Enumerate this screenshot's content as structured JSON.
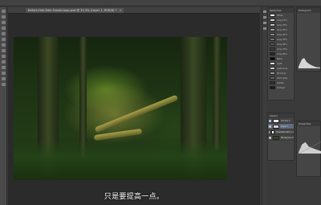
{
  "document": {
    "tab_title": "Before-Hoh-Rain-Forest-Loop.psd @ 33.3% (Layer 1, RGB/8) *",
    "close_glyph": "×"
  },
  "subtitle": "只是要提高一点。",
  "colors": {
    "workspace_bg": "#2b2b2b",
    "panel_bg": "#454545",
    "selected_layer": "#5e6c7f"
  },
  "panels": {
    "swatches": {
      "title": "Swatches",
      "items": [
        {
          "color": "#ffffff",
          "label": "White"
        },
        {
          "color": "#d9d9d9",
          "label": "Gray 15%"
        },
        {
          "color": "#bfbfbf",
          "label": "Gray 25%"
        },
        {
          "color": "#a6a6a6",
          "label": "Gray 35%"
        },
        {
          "color": "#8c8c8c",
          "label": "Gray 45%"
        },
        {
          "color": "#737373",
          "label": "Gray 55%"
        },
        {
          "color": "#595959",
          "label": "Gray 65%"
        },
        {
          "color": "#404040",
          "label": "Gray 75%"
        },
        {
          "color": "#262626",
          "label": "Gray 85%"
        },
        {
          "color": "#000000",
          "label": "Black"
        },
        {
          "color": "#e6e6e6",
          "label": "Light"
        },
        {
          "color": "#cccccc",
          "label": "Light Gray"
        },
        {
          "color": "#999999",
          "label": "Mid Gray"
        },
        {
          "color": "#666666",
          "label": "Dark Gray"
        },
        {
          "color": "#333333",
          "label": "Darker"
        },
        {
          "color": "#1a1a1a",
          "label": "Darkest"
        }
      ]
    },
    "histogram": {
      "title": "Histogram"
    },
    "navigator": {
      "title": "Navigator"
    },
    "layers": {
      "title": "Layers",
      "items": [
        {
          "label": "Curves 1",
          "thumb": "#e8e8e8",
          "selected": false
        },
        {
          "label": "Layer 1",
          "thumb": "#cfcfcf",
          "selected": true
        },
        {
          "label": "Hue/Saturation 1",
          "thumb": "#ffffff",
          "selected": false
        },
        {
          "label": "Background",
          "thumb": "#2d4a1c",
          "selected": false
        }
      ]
    },
    "properties": {
      "title": "Properties"
    }
  }
}
